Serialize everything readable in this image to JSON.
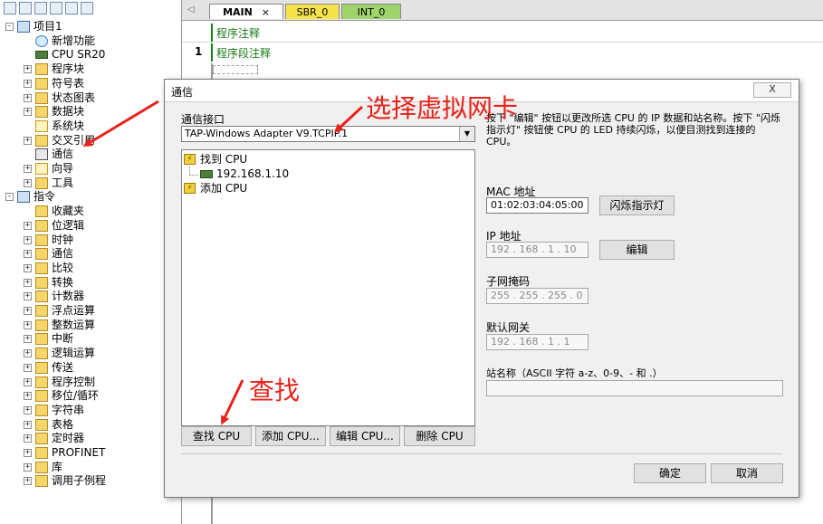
{
  "tree": {
    "items": [
      {
        "label": "项目1",
        "level": 0,
        "expander": "-",
        "icon": "project-icon"
      },
      {
        "label": "新增功能",
        "level": 1,
        "expander": "",
        "icon": "new-features-icon"
      },
      {
        "label": "CPU SR20",
        "level": 1,
        "expander": "",
        "icon": "cpu-icon"
      },
      {
        "label": "程序块",
        "level": 1,
        "expander": "+",
        "icon": "folder-icon"
      },
      {
        "label": "符号表",
        "level": 1,
        "expander": "+",
        "icon": "folder-icon"
      },
      {
        "label": "状态图表",
        "level": 1,
        "expander": "+",
        "icon": "folder-icon"
      },
      {
        "label": "数据块",
        "level": 1,
        "expander": "+",
        "icon": "folder-icon"
      },
      {
        "label": "系统块",
        "level": 1,
        "expander": "",
        "icon": "system-block-icon"
      },
      {
        "label": "交叉引用",
        "level": 1,
        "expander": "+",
        "icon": "folder-icon"
      },
      {
        "label": "通信",
        "level": 1,
        "expander": "",
        "icon": "communication-icon"
      },
      {
        "label": "向导",
        "level": 1,
        "expander": "+",
        "icon": "wizard-icon"
      },
      {
        "label": "工具",
        "level": 1,
        "expander": "+",
        "icon": "folder-icon"
      },
      {
        "label": "指令",
        "level": 0,
        "expander": "-",
        "icon": "instructions-icon"
      },
      {
        "label": "收藏夹",
        "level": 1,
        "expander": "",
        "icon": "folder-icon"
      },
      {
        "label": "位逻辑",
        "level": 1,
        "expander": "+",
        "icon": "folder-icon"
      },
      {
        "label": "时钟",
        "level": 1,
        "expander": "+",
        "icon": "folder-icon"
      },
      {
        "label": "通信",
        "level": 1,
        "expander": "+",
        "icon": "folder-icon"
      },
      {
        "label": "比较",
        "level": 1,
        "expander": "+",
        "icon": "folder-icon"
      },
      {
        "label": "转换",
        "level": 1,
        "expander": "+",
        "icon": "folder-icon"
      },
      {
        "label": "计数器",
        "level": 1,
        "expander": "+",
        "icon": "folder-icon"
      },
      {
        "label": "浮点运算",
        "level": 1,
        "expander": "+",
        "icon": "folder-icon"
      },
      {
        "label": "整数运算",
        "level": 1,
        "expander": "+",
        "icon": "folder-icon"
      },
      {
        "label": "中断",
        "level": 1,
        "expander": "+",
        "icon": "folder-icon"
      },
      {
        "label": "逻辑运算",
        "level": 1,
        "expander": "+",
        "icon": "folder-icon"
      },
      {
        "label": "传送",
        "level": 1,
        "expander": "+",
        "icon": "folder-icon"
      },
      {
        "label": "程序控制",
        "level": 1,
        "expander": "+",
        "icon": "folder-icon"
      },
      {
        "label": "移位/循环",
        "level": 1,
        "expander": "+",
        "icon": "folder-icon"
      },
      {
        "label": "字符串",
        "level": 1,
        "expander": "+",
        "icon": "folder-icon"
      },
      {
        "label": "表格",
        "level": 1,
        "expander": "+",
        "icon": "folder-icon"
      },
      {
        "label": "定时器",
        "level": 1,
        "expander": "+",
        "icon": "folder-icon"
      },
      {
        "label": "PROFINET",
        "level": 1,
        "expander": "+",
        "icon": "folder-icon"
      },
      {
        "label": "库",
        "level": 1,
        "expander": "+",
        "icon": "folder-icon"
      },
      {
        "label": "调用子例程",
        "level": 1,
        "expander": "+",
        "icon": "folder-icon"
      }
    ]
  },
  "editor": {
    "tabs": {
      "main": "MAIN",
      "main_close": "×",
      "sbr": "SBR_0",
      "int": "INT_0"
    },
    "program_comment": "程序注释",
    "rung_number": "1",
    "network_comment": "程序段注释"
  },
  "dialog": {
    "title": "通信",
    "close": "X",
    "interface_label": "通信接口",
    "interface_value": "TAP-Windows Adapter V9.TCPIP.1",
    "tree": {
      "found": "找到 CPU",
      "ip_item": "192.168.1.10",
      "add": "添加 CPU"
    },
    "buttons": {
      "find": "查找 CPU",
      "add": "添加 CPU...",
      "edit": "编辑 CPU...",
      "delete": "删除 CPU",
      "flash": "闪烁指示灯",
      "edit_ip": "编辑",
      "ok": "确定",
      "cancel": "取消"
    },
    "instructions": "按下 \"编辑\" 按钮以更改所选 CPU 的 IP 数据和站名称。按下 \"闪烁指示灯\" 按钮使 CPU 的 LED 持续闪烁，以便目测找到连接的 CPU。",
    "mac_label": "MAC 地址",
    "mac_value": "01:02:03:04:05:00",
    "ip_label": "IP 地址",
    "ip_value": "192 . 168 .  1  . 10",
    "subnet_label": "子网掩码",
    "subnet_value": "255 . 255 . 255 .  0",
    "gateway_label": "默认网关",
    "gateway_value": "192 . 168 .  1  .  1",
    "station_label": "站名称（ASCII 字符 a-z、0-9、- 和 .）",
    "station_value": ""
  },
  "annotations": {
    "select_nic": "选择虚拟网卡",
    "find": "查找"
  },
  "colors": {
    "annotation": "#e8221a",
    "accent_green": "#1a7a1a"
  }
}
